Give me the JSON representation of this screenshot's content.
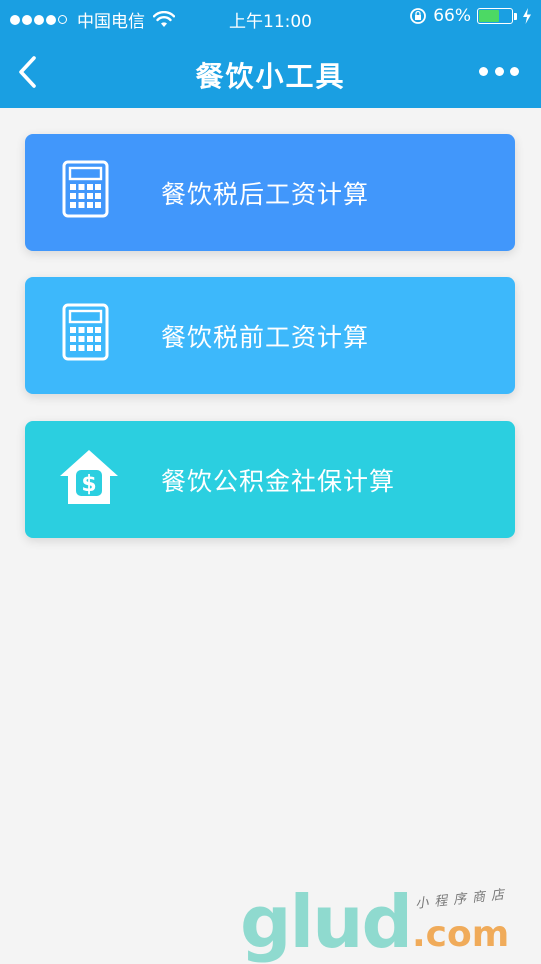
{
  "status_bar": {
    "carrier": "中国电信",
    "time": "上午11:00",
    "battery_percent": "66%",
    "battery_level": 0.66,
    "signal_filled": 4,
    "signal_total": 5
  },
  "nav": {
    "title": "餐饮小工具"
  },
  "cards": [
    {
      "label": "餐饮税后工资计算",
      "color": "#4197fb",
      "icon": "calculator-icon"
    },
    {
      "label": "餐饮税前工资计算",
      "color": "#3db8fb",
      "icon": "calculator-icon"
    },
    {
      "label": "餐饮公积金社保计算",
      "color": "#2bcfe0",
      "icon": "house-dollar-icon"
    }
  ],
  "watermark": {
    "main": "glud",
    "domain": ".com",
    "subtitle": "小程序商店"
  },
  "colors": {
    "nav_background": "#1a9fe2",
    "page_background": "#f4f4f4"
  }
}
